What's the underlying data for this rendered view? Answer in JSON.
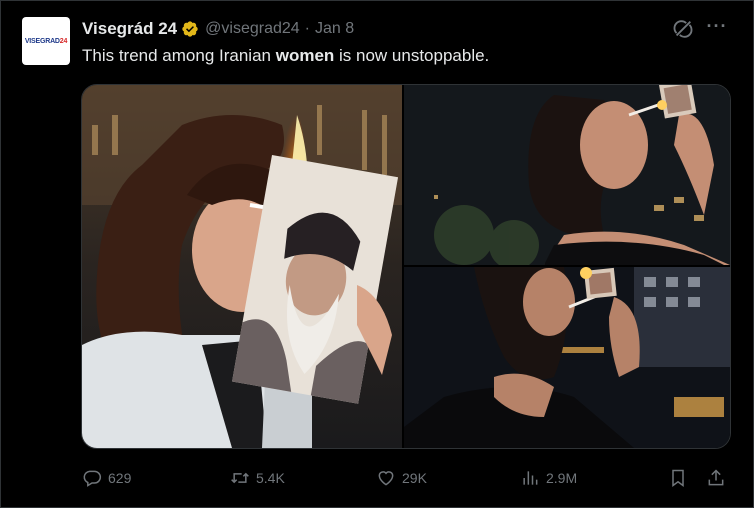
{
  "tweet": {
    "avatar_text_prefix": "VISEGRAD",
    "avatar_text_suffix": "24",
    "display_name": "Visegrád 24",
    "handle": "@visegrad24",
    "separator": "·",
    "date": "Jan 8",
    "text_before": "This trend among Iranian ",
    "text_bold": "women",
    "text_after": " is now unstoppable.",
    "more_label": "···"
  },
  "actions": {
    "replies": "629",
    "retweets": "5.4K",
    "likes": "29K",
    "views": "2.9M"
  },
  "icons": {
    "avatar": "visegrad24-logo",
    "verified": "verified-badge-icon",
    "grok": "grok-icon",
    "more": "more-icon",
    "reply": "reply-icon",
    "retweet": "retweet-icon",
    "like": "heart-icon",
    "views": "views-chart-icon",
    "bookmark": "bookmark-icon",
    "share": "share-icon"
  },
  "colors": {
    "background": "#000000",
    "text": "#e7e9ea",
    "muted": "#71767b",
    "border": "#2f3336",
    "verified_gold": "#e2b719"
  }
}
